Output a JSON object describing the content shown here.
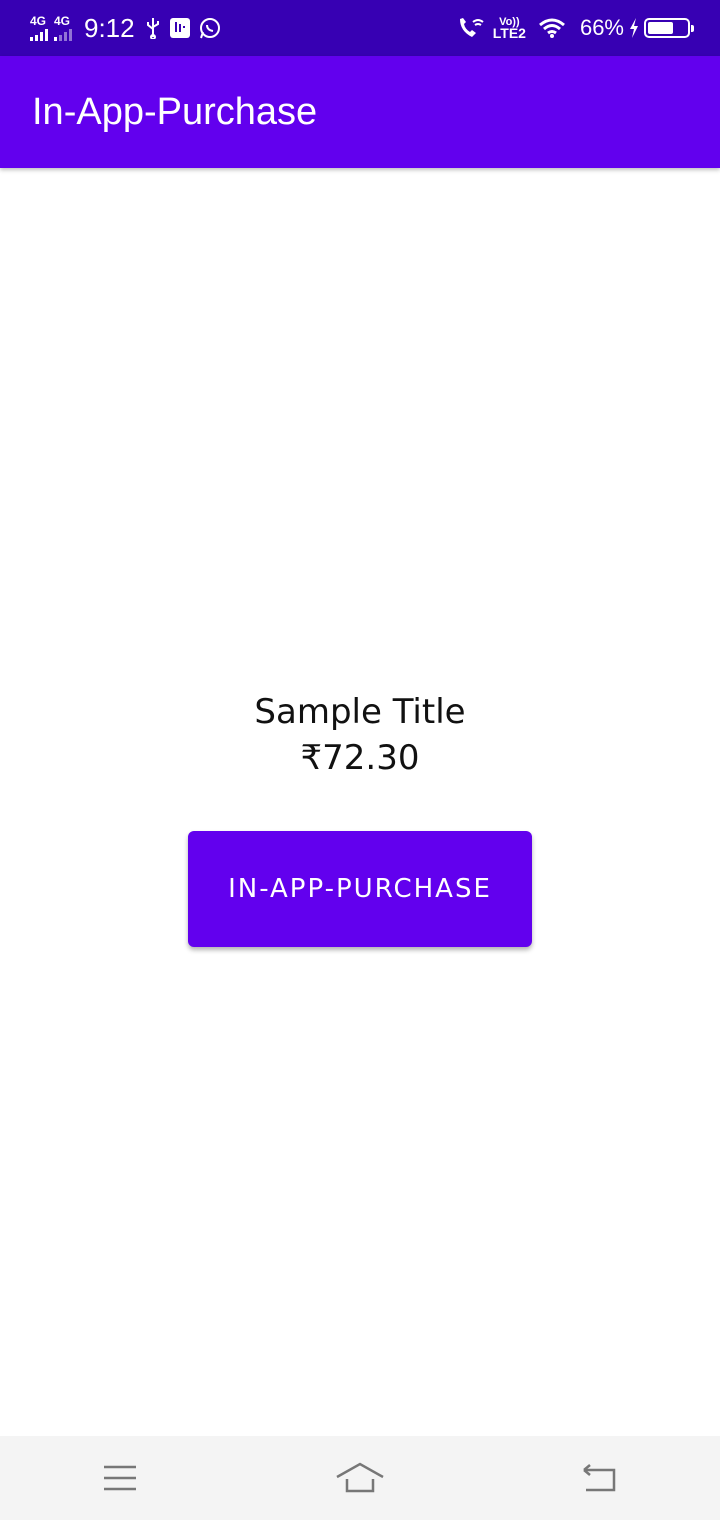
{
  "status_bar": {
    "sim1_tag": "4G",
    "sim2_tag": "4G",
    "time": "9:12",
    "volte_label": "Vo))",
    "lte_label": "LTE2",
    "battery_percent": "66%",
    "battery_level": 0.66,
    "icons": [
      "usb-icon",
      "usb-debug-icon",
      "whatsapp-icon",
      "wifi-calling-icon",
      "wifi-icon",
      "charging-icon",
      "battery-icon"
    ]
  },
  "app_bar": {
    "title": "In-App-Purchase",
    "color": "#6200ee"
  },
  "product": {
    "title": "Sample Title",
    "price": "₹72.30"
  },
  "purchase_button": {
    "label": "IN-APP-PURCHASE",
    "color": "#6200ee"
  },
  "nav_bar": {
    "icons": [
      "menu-icon",
      "home-icon",
      "back-icon"
    ]
  }
}
